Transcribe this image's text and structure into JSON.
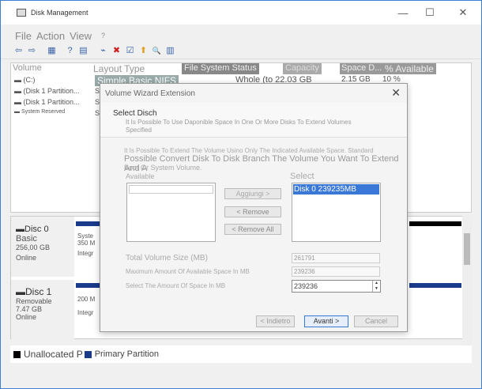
{
  "window": {
    "title": "Disk Management",
    "minimize": "—",
    "maximize": "☐",
    "close": "✕"
  },
  "menu": {
    "file": "File",
    "action": "Action",
    "view": "View",
    "help": "?"
  },
  "toolbar": [
    {
      "icon": "back-arrow-icon",
      "glyph": "⇦"
    },
    {
      "icon": "forward-arrow-icon",
      "glyph": "⇨"
    },
    {
      "icon": "grid-icon",
      "glyph": "▦"
    },
    {
      "icon": "help-icon",
      "glyph": "?"
    },
    {
      "icon": "list-icon",
      "glyph": "▤"
    },
    {
      "icon": "connect-icon",
      "glyph": "⌁"
    },
    {
      "icon": "delete-icon",
      "glyph": "✖"
    },
    {
      "icon": "check-icon",
      "glyph": "☑"
    },
    {
      "icon": "folder-up-icon",
      "glyph": "⬆"
    },
    {
      "icon": "search-icon",
      "glyph": "🔍"
    },
    {
      "icon": "properties-icon",
      "glyph": "▥"
    }
  ],
  "volume_list": {
    "headers": [
      "Volume",
      "Layout Type",
      "File System Status",
      "Capacity",
      "Space D...",
      "% Available"
    ],
    "rows": [
      {
        "volume": "(C:)",
        "layout": "Simple Basic NIFS",
        "status": "Whole (to 22.03 GB",
        "space": "2.15 GB",
        "percent": "10 %"
      },
      {
        "volume": "(Disk 1 Partition...",
        "layout": "S",
        "status": "",
        "space": "",
        "percent": ""
      },
      {
        "volume": "(Disk 1 Partition...",
        "layout": "S",
        "status": "",
        "space": "",
        "percent": ""
      },
      {
        "volume": "System Reserved",
        "layout": "S",
        "status": "",
        "space": "",
        "percent": ""
      }
    ]
  },
  "disks": [
    {
      "name": "Disc 0",
      "type": "Basic",
      "size": "256,00 GB",
      "status": "Online",
      "part_name": "Syste",
      "part_size": "350 M",
      "part_state": "Integr"
    },
    {
      "name": "Disc 1",
      "type": "Removable",
      "size": "7.47 GB",
      "status": "Online",
      "part_name": "200 M",
      "part_size": "",
      "part_state": "Integr"
    }
  ],
  "legend": {
    "unallocated": "Unallocated P",
    "primary": "Primary Partition"
  },
  "dialog": {
    "title": "Volume Wizard Extension",
    "close": "✕",
    "header_title": "Select Disch",
    "header_sub": "It Is Possible To Use Daponible Space In One Or More Disks To Extend Volumes Specified",
    "info_small": "It Is Possible To Extend The Volume Usino Only The Indicated Available Space. Standard",
    "info_large": "Possible Convert Disk To Disk Branch The Volume You Want To Extend And A",
    "info_tail": "Boot Or System Volume.",
    "available_label": "Available",
    "selected_label": "Select",
    "selected_items": [
      "Disk 0 239235MB"
    ],
    "add_button": "Aggiungi >",
    "remove_button": "< Remove",
    "remove_all_button": "< Remove All",
    "total_label": "Total Volume Size (MB)",
    "total_value": "261791",
    "max_label": "Maximum Amount Of Available Space In MB",
    "max_value": "239236",
    "select_label": "Select The Amount Of Space In MB",
    "select_value": "239236",
    "back_button": "< Indietro",
    "next_button": "Avanti >",
    "cancel_button": "Cancel"
  }
}
